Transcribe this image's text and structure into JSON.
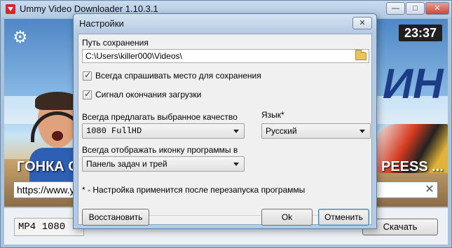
{
  "main_window": {
    "title": "Ummy Video Downloader 1.10.3.1",
    "controls": {
      "minimize": "—",
      "maximize": "□",
      "close": "✕"
    },
    "icon": "download-icon"
  },
  "banner": {
    "clock": "23:37",
    "video_title_left": "ГОНКА С",
    "video_title_right": "PEESS ...",
    "title_letters": "ИН",
    "settings_icon": "gear-icon"
  },
  "url_field": {
    "value": "https://www.yo"
  },
  "bottom": {
    "format_value": "MP4  1080",
    "download_label": "Скачать"
  },
  "dialog": {
    "title": "Настройки",
    "close_label": "✕",
    "save_path_label": "Путь сохранения",
    "save_path_value": "C:\\Users\\killer000\\Videos\\",
    "folder_icon": "folder-icon",
    "checkboxes": [
      {
        "label": "Всегда спрашивать место для сохранения",
        "checked": true
      },
      {
        "label": "Сигнал окончания загрузки",
        "checked": true
      }
    ],
    "quality_label": "Всегда предлагать выбранное качество",
    "quality_value": "1080 FullHD",
    "language_label": "Язык*",
    "language_value": "Русский",
    "icon_display_label": "Всегда отображать иконку программы в",
    "icon_display_value": "Панель задач и трей",
    "note": "* - Настройка применится после перезапуска программы",
    "buttons": {
      "restore": "Восстановить",
      "ok": "Ok",
      "cancel": "Отменить"
    }
  }
}
